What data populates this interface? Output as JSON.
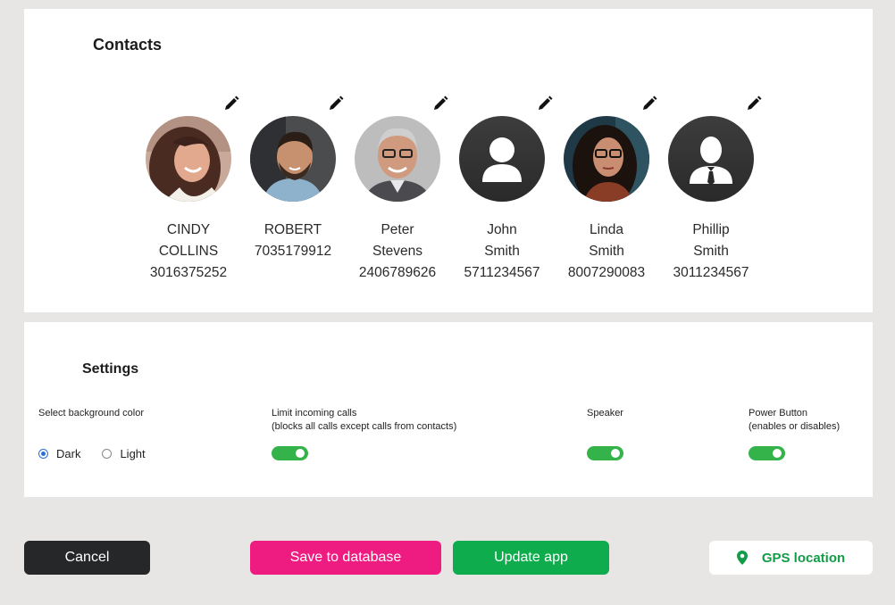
{
  "contacts": {
    "title": "Contacts",
    "items": [
      {
        "first": "CINDY",
        "last": "COLLINS",
        "phone": "3016375252",
        "avatar": "photo-woman-smiling"
      },
      {
        "first": "ROBERT",
        "last": "",
        "phone": "7035179912",
        "avatar": "photo-man-beard"
      },
      {
        "first": "Peter",
        "last": "Stevens",
        "phone": "2406789626",
        "avatar": "photo-man-glasses"
      },
      {
        "first": "John",
        "last": "Smith",
        "phone": "5711234567",
        "avatar": "placeholder-person"
      },
      {
        "first": "Linda",
        "last": "Smith",
        "phone": "8007290083",
        "avatar": "photo-woman-glasses"
      },
      {
        "first": "Phillip",
        "last": "Smith",
        "phone": "3011234567",
        "avatar": "placeholder-person-tie"
      }
    ]
  },
  "settings": {
    "title": "Settings",
    "background": {
      "label": "Select background color",
      "options": [
        {
          "label": "Dark",
          "checked": true
        },
        {
          "label": "Light",
          "checked": false
        }
      ]
    },
    "limit_calls": {
      "label": "Limit incoming calls",
      "sublabel": "(blocks all calls except calls from contacts)",
      "enabled": true
    },
    "speaker": {
      "label": "Speaker",
      "enabled": true
    },
    "power_button": {
      "label": "Power Button",
      "sublabel": "(enables or disables)",
      "enabled": true
    }
  },
  "actions": {
    "cancel": "Cancel",
    "save": "Save to database",
    "update": "Update app",
    "gps": "GPS location"
  },
  "colors": {
    "toggle_on": "#34b34a",
    "cancel": "#262728",
    "save": "#ee1b80",
    "update": "#0fac4d",
    "gps_text": "#129c47"
  }
}
